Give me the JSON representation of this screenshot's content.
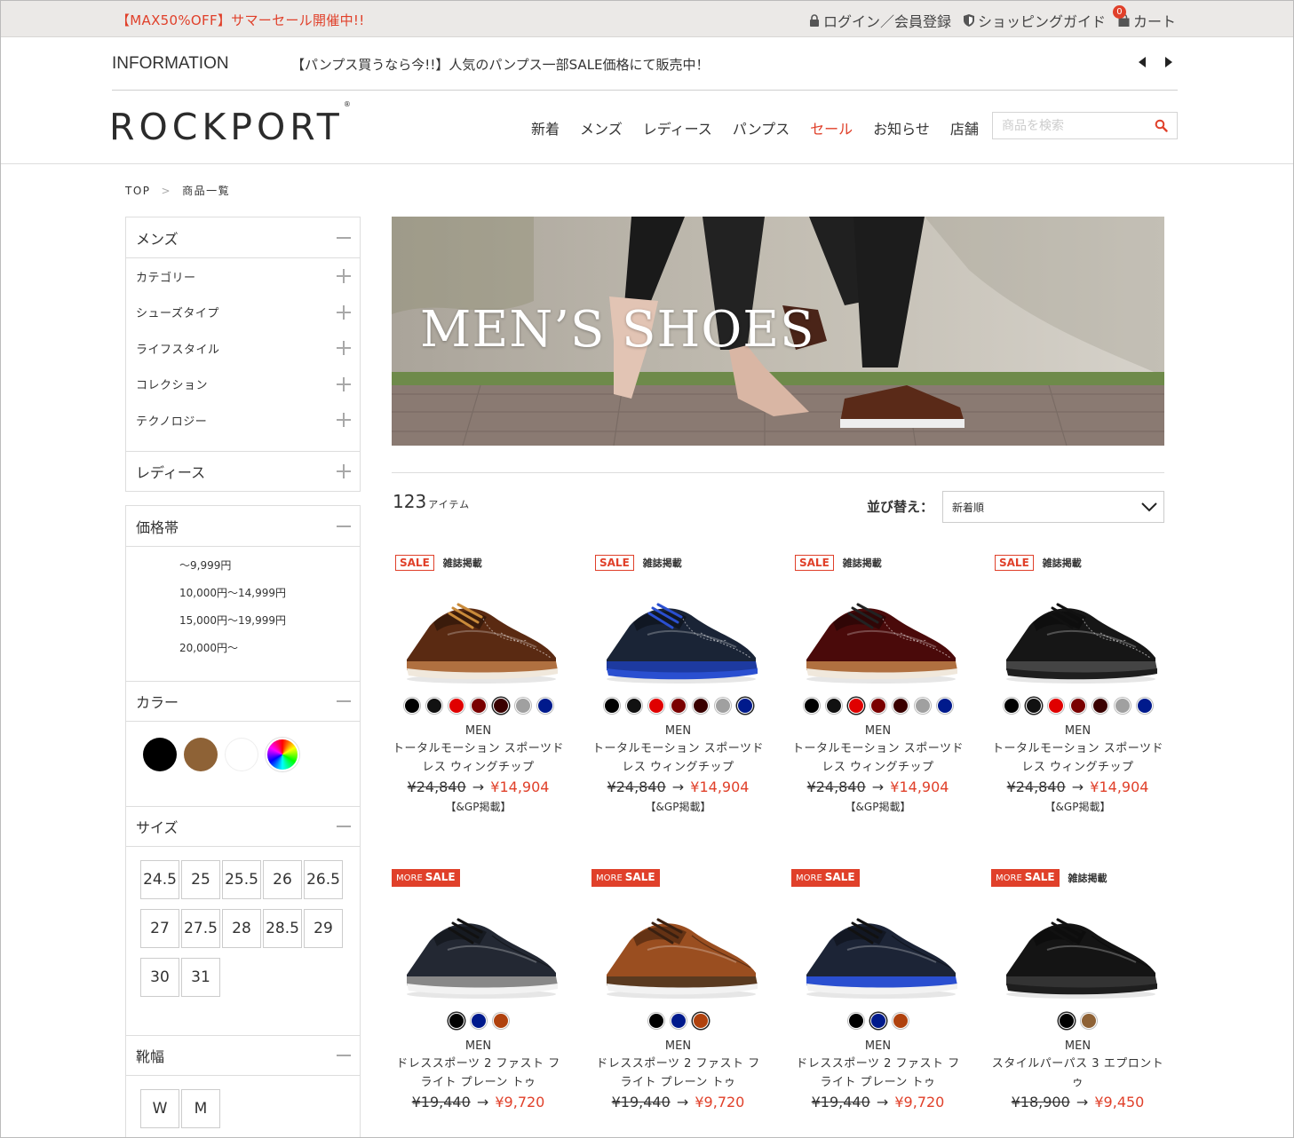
{
  "topbar": {
    "promo": "【MAX50%OFF】サマーセール開催中!!",
    "login": "ログイン／会員登録",
    "guide": "ショッピングガイド",
    "cart": "カート",
    "cart_count": "0"
  },
  "info": {
    "label": "INFORMATION",
    "text": "【パンプス買うなら今!!】人気のパンプス一部SALE価格にて販売中！"
  },
  "header": {
    "logo": "ROCKPORT",
    "logo_mark": "®",
    "nav": [
      "新着",
      "メンズ",
      "レディース",
      "パンプス",
      "セール",
      "お知らせ",
      "店舗"
    ],
    "search_placeholder": "商品を検索"
  },
  "breadcrumb": [
    "TOP",
    "商品一覧"
  ],
  "sidebar": {
    "mens": {
      "title": "メンズ",
      "items": [
        "カテゴリー",
        "シューズタイプ",
        "ライフスタイル",
        "コレクション",
        "テクノロジー"
      ]
    },
    "ladies": "レディース",
    "price": {
      "title": "価格帯",
      "items": [
        "～9,999円",
        "10,000円～14,999円",
        "15,000円～19,999円",
        "20,000円～"
      ]
    },
    "color": {
      "title": "カラー",
      "swatches": [
        "#000000",
        "#8e6236",
        "#ffffff",
        "rainbow"
      ]
    },
    "size": {
      "title": "サイズ",
      "items": [
        "24.5",
        "25",
        "25.5",
        "26",
        "26.5",
        "27",
        "27.5",
        "28",
        "28.5",
        "29",
        "30",
        "31"
      ]
    },
    "width": {
      "title": "靴幅",
      "items": [
        "W",
        "M"
      ]
    }
  },
  "main": {
    "banner_title": "MEN’S SHOES",
    "count": "123",
    "count_unit": "アイテム",
    "sort_label": "並び替え：",
    "sort_value": "新着順"
  },
  "badges": {
    "sale": "SALE",
    "more": "MORE",
    "magazine": "雑誌掲載"
  },
  "products": [
    {
      "cat": "MEN",
      "name": "トータルモーション スポーツドレス ウィングチップ",
      "old": "¥24,840",
      "new": "¥14,904",
      "note": "【&GP掲載】",
      "badge": "sale",
      "mag": true,
      "colors": [
        "#000000",
        "#111111",
        "#e00000",
        "#7a0000",
        "#3a0000",
        "#a0a0a0",
        "#001a8c"
      ],
      "sel": 4,
      "shoe": {
        "upper": "#5a2a12",
        "sole": "#f0e8dc",
        "mid": "#b07040",
        "lace": "#c98a3a"
      }
    },
    {
      "cat": "MEN",
      "name": "トータルモーション スポーツドレス ウィングチップ",
      "old": "¥24,840",
      "new": "¥14,904",
      "note": "【&GP掲載】",
      "badge": "sale",
      "mag": true,
      "colors": [
        "#000000",
        "#111111",
        "#e00000",
        "#7a0000",
        "#3a0000",
        "#a0a0a0",
        "#001a8c"
      ],
      "sel": 6,
      "shoe": {
        "upper": "#1a2436",
        "sole": "#2a4fd0",
        "mid": "#1d3aa0",
        "lace": "#2a4fd0"
      }
    },
    {
      "cat": "MEN",
      "name": "トータルモーション スポーツドレス ウィングチップ",
      "old": "¥24,840",
      "new": "¥14,904",
      "note": "【&GP掲載】",
      "badge": "sale",
      "mag": true,
      "colors": [
        "#000000",
        "#111111",
        "#e00000",
        "#7a0000",
        "#3a0000",
        "#a0a0a0",
        "#001a8c"
      ],
      "sel": 2,
      "shoe": {
        "upper": "#4a0a0a",
        "sole": "#f0e8dc",
        "mid": "#b07040",
        "lace": "#222222"
      }
    },
    {
      "cat": "MEN",
      "name": "トータルモーション スポーツドレス ウィングチップ",
      "old": "¥24,840",
      "new": "¥14,904",
      "note": "【&GP掲載】",
      "badge": "sale",
      "mag": true,
      "colors": [
        "#000000",
        "#111111",
        "#e00000",
        "#7a0000",
        "#3a0000",
        "#a0a0a0",
        "#001a8c"
      ],
      "sel": 1,
      "shoe": {
        "upper": "#161616",
        "sole": "#1e1e1e",
        "mid": "#444444",
        "lace": "#111111"
      }
    },
    {
      "cat": "MEN",
      "name": "ドレススポーツ 2 ファスト フライト プレーン トゥ",
      "old": "¥19,440",
      "new": "¥9,720",
      "note": "",
      "badge": "more",
      "mag": false,
      "colors": [
        "#000000",
        "#001a8c",
        "#b0420e"
      ],
      "sel": 0,
      "shoe": {
        "upper": "#232833",
        "sole": "#f2f2f2",
        "mid": "#888888",
        "lace": "#111111"
      }
    },
    {
      "cat": "MEN",
      "name": "ドレススポーツ 2 ファスト フライト プレーン トゥ",
      "old": "¥19,440",
      "new": "¥9,720",
      "note": "",
      "badge": "more",
      "mag": false,
      "colors": [
        "#000000",
        "#001a8c",
        "#b0420e"
      ],
      "sel": 2,
      "shoe": {
        "upper": "#9a4e20",
        "sole": "#f2f2f2",
        "mid": "#5a3a20",
        "lace": "#3a2010"
      }
    },
    {
      "cat": "MEN",
      "name": "ドレススポーツ 2 ファスト フライト プレーン トゥ",
      "old": "¥19,440",
      "new": "¥9,720",
      "note": "",
      "badge": "more",
      "mag": false,
      "colors": [
        "#000000",
        "#001a8c",
        "#b0420e"
      ],
      "sel": 1,
      "shoe": {
        "upper": "#1c2436",
        "sole": "#f2f2f2",
        "mid": "#2a4fd0",
        "lace": "#111111"
      }
    },
    {
      "cat": "MEN",
      "name": "スタイルパーパス 3 エプロントゥ",
      "old": "¥18,900",
      "new": "¥9,450",
      "note": "",
      "badge": "more",
      "mag": true,
      "colors": [
        "#000000",
        "#8e6236"
      ],
      "sel": 0,
      "shoe": {
        "upper": "#141414",
        "sole": "#1e1e1e",
        "mid": "#333333",
        "lace": "#111111"
      }
    }
  ]
}
